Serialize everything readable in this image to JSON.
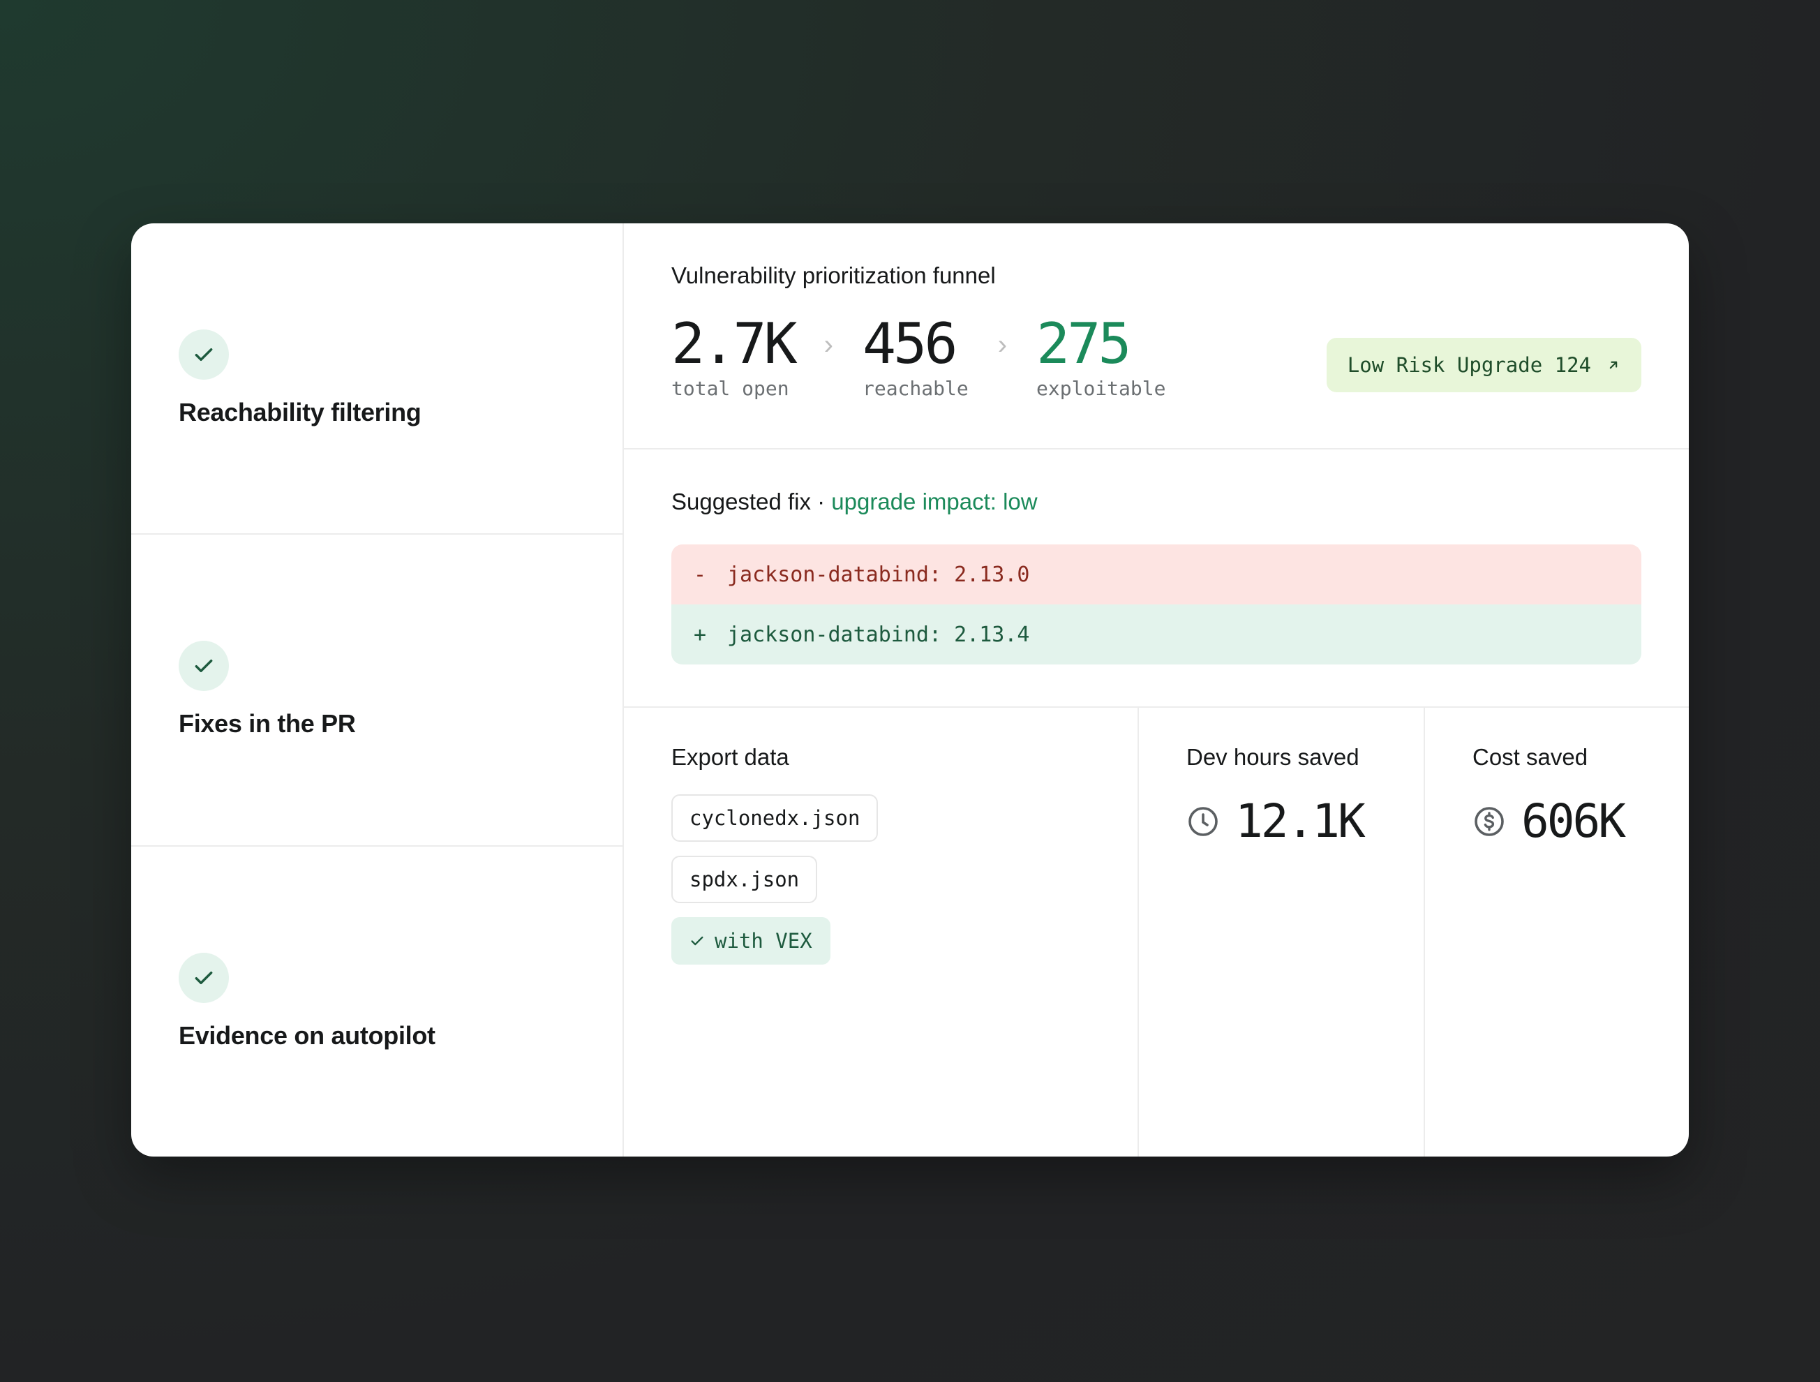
{
  "features": [
    {
      "label": "Reachability filtering",
      "icon": "check-icon"
    },
    {
      "label": "Fixes in the PR",
      "icon": "check-icon"
    },
    {
      "label": "Evidence on autopilot",
      "icon": "check-icon"
    }
  ],
  "funnel": {
    "title": "Vulnerability prioritization funnel",
    "stats": [
      {
        "value": "2.7K",
        "label": "total open"
      },
      {
        "value": "456",
        "label": "reachable"
      },
      {
        "value": "275",
        "label": "exploitable"
      }
    ],
    "separator": "›",
    "badge": "Low Risk Upgrade 124"
  },
  "fix": {
    "title": "Suggested fix · ",
    "impact": "upgrade impact: low",
    "removed": {
      "sign": "-",
      "text": "jackson-databind: 2.13.0"
    },
    "added": {
      "sign": "+",
      "text": "jackson-databind: 2.13.4"
    }
  },
  "export": {
    "title": "Export data",
    "files": [
      "cyclonedx.json",
      "spdx.json"
    ],
    "vex": "with VEX"
  },
  "dev_hours": {
    "title": "Dev hours saved",
    "value": "12.1K",
    "icon": "clock-icon"
  },
  "cost": {
    "title": "Cost saved",
    "value": "606K",
    "icon": "dollar-icon"
  },
  "colors": {
    "accent_green": "#1b8a5a",
    "diff_removed_bg": "#fde4e2",
    "diff_added_bg": "#e3f3ec",
    "badge_bg": "#e8f6d9"
  }
}
